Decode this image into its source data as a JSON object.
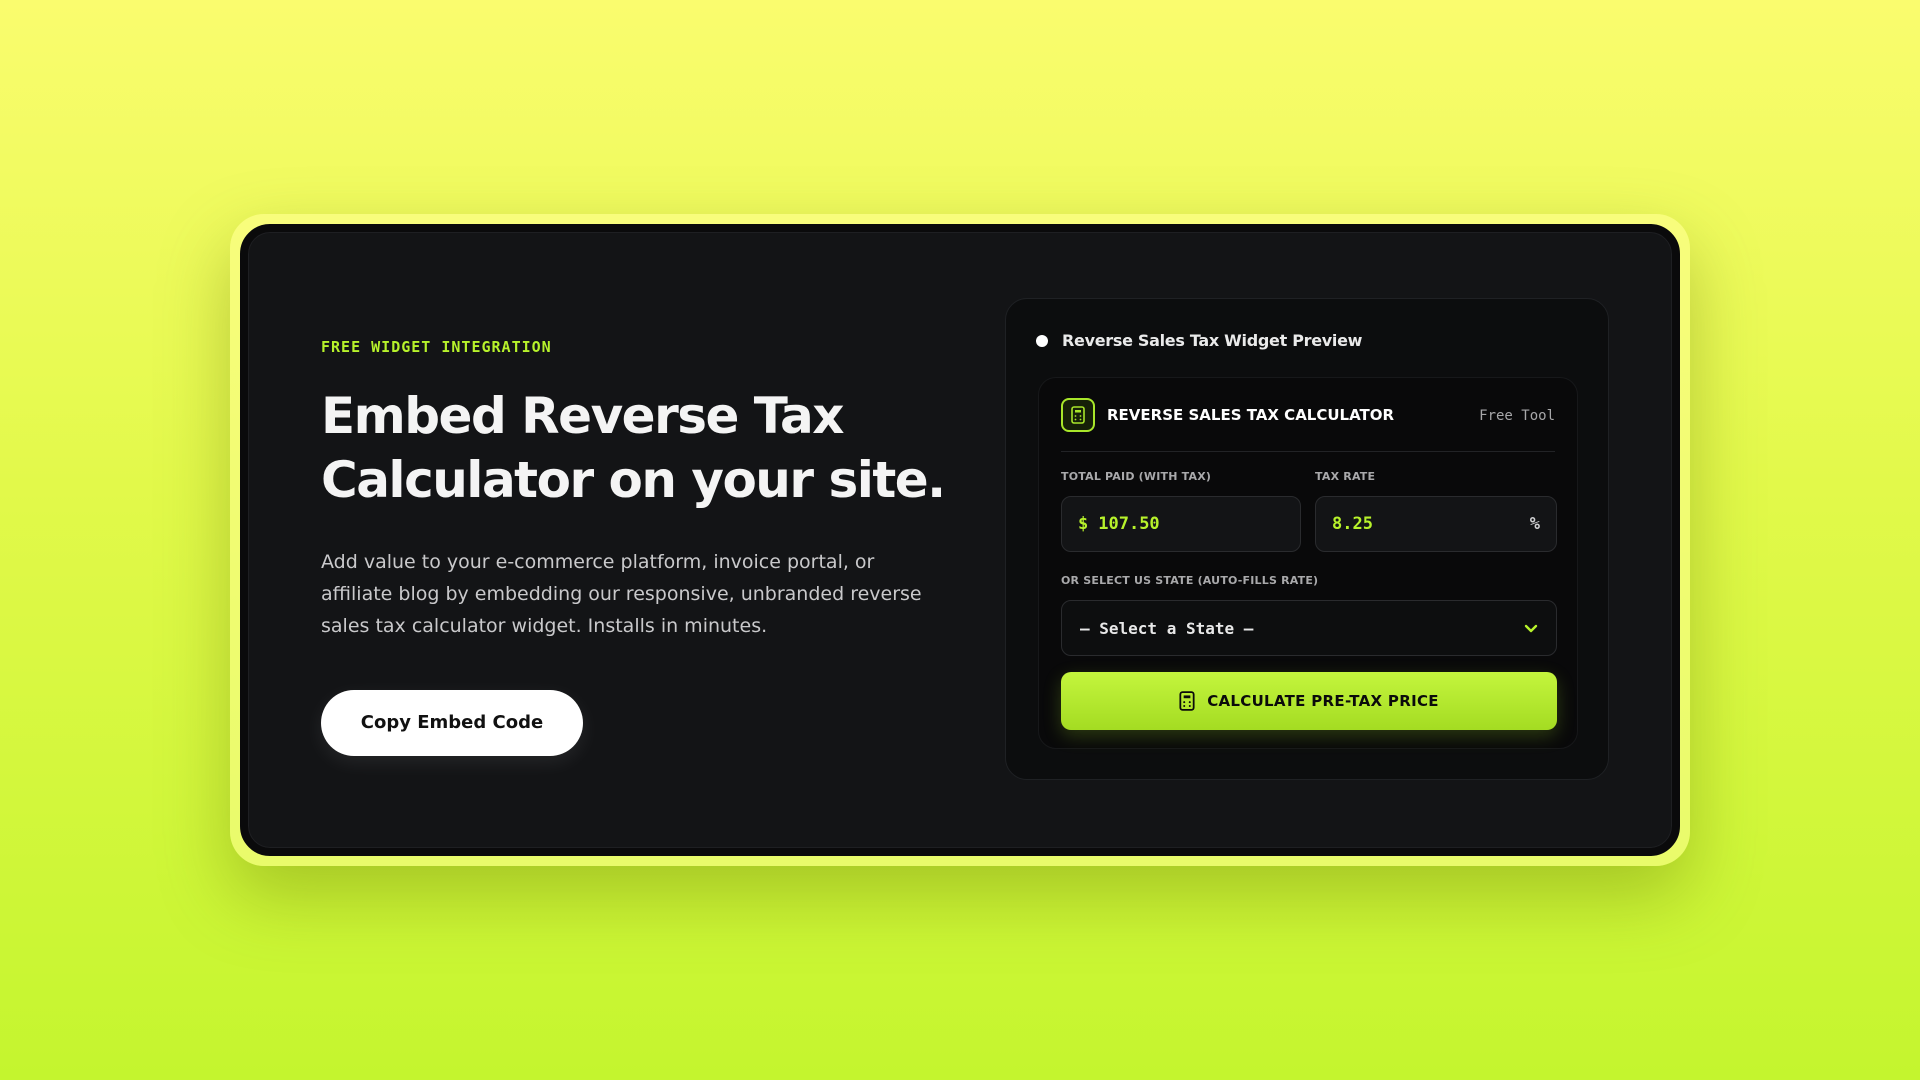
{
  "left": {
    "eyebrow": "FREE WIDGET INTEGRATION",
    "headline_line1": "Embed Reverse Tax",
    "headline_line2": "Calculator on your site.",
    "description": "Add value to your e-commerce platform, invoice portal, or affiliate blog by embedding our responsive, unbranded reverse sales tax calculator widget. Installs in minutes.",
    "copy_button_label": "Copy Embed Code"
  },
  "preview": {
    "title": "Reverse Sales Tax Widget Preview",
    "widget": {
      "title": "REVERSE SALES TAX CALCULATOR",
      "tag": "Free Tool",
      "total_paid_label": "TOTAL PAID (WITH TAX)",
      "currency_symbol": "$",
      "total_paid_value": "107.50",
      "tax_rate_label": "TAX RATE",
      "tax_rate_value": "8.25",
      "percent_symbol": "%",
      "state_label": "OR SELECT US STATE (AUTO-FILLS RATE)",
      "state_selected": "— Select a State —",
      "calculate_label": "CALCULATE PRE-TAX PRICE"
    }
  },
  "colors": {
    "accent": "#b7f22b",
    "card_bg": "#131416",
    "widget_bg": "#09090a"
  },
  "icons": {
    "widget_icon": "calculator-icon",
    "select_chevron": "chevron-down-icon",
    "button_icon": "calculator-icon"
  }
}
